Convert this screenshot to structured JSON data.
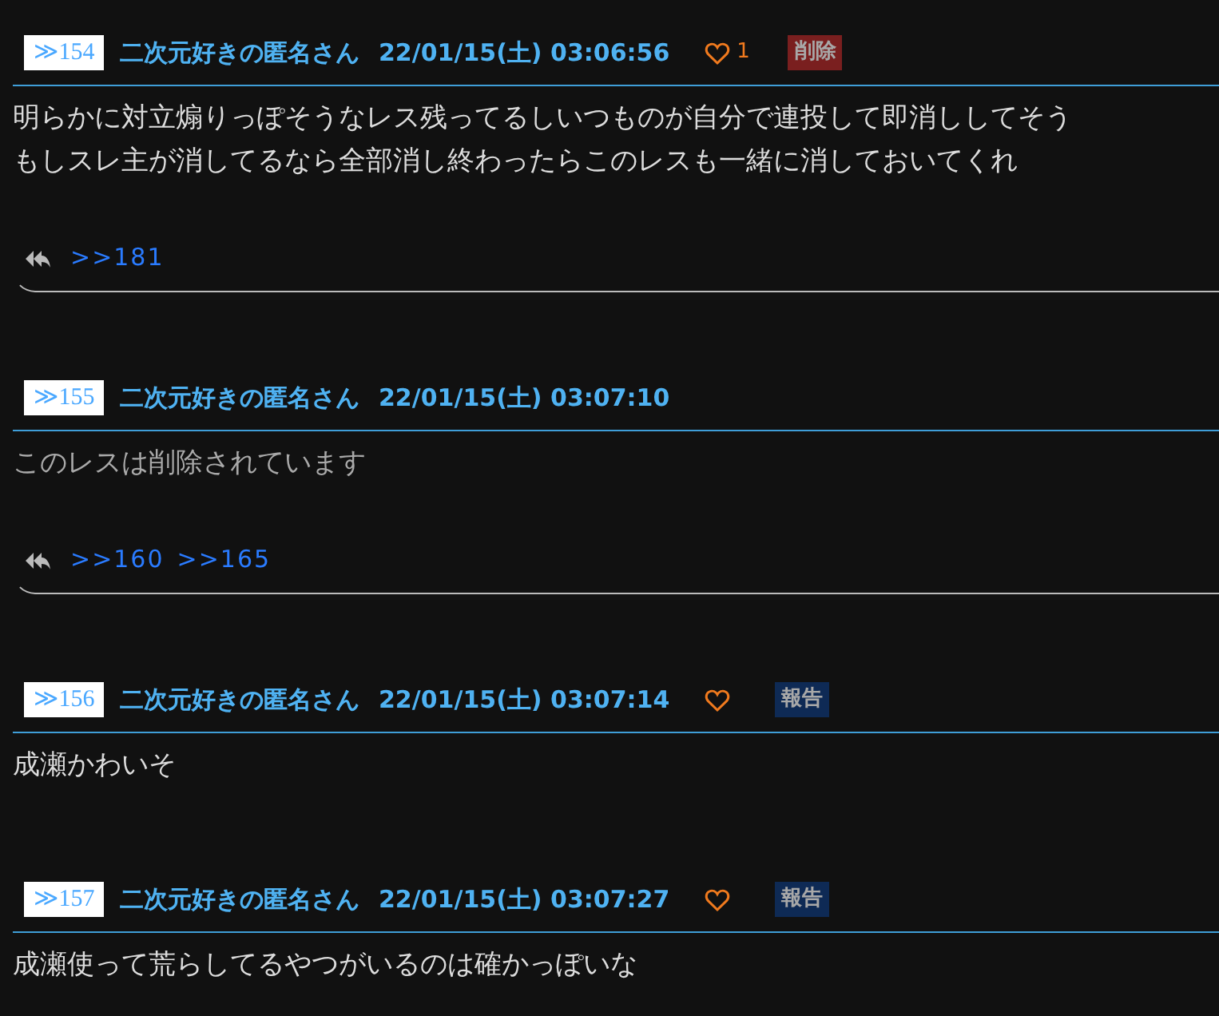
{
  "posts": [
    {
      "number": "≫154",
      "name": "二次元好きの匿名さん",
      "date": "22/01/15(土) 03:06:56",
      "like_button": true,
      "like_count": "1",
      "action": {
        "kind": "delete",
        "label": "削除"
      },
      "deleted": false,
      "body": [
        "明らかに対立煽りっぽそうなレス残ってるしいつものが自分で連投して即消ししてそう",
        "もしスレ主が消してるなら全部消し終わったらこのレスも一緒に消しておいてくれ"
      ],
      "replies": [
        ">>181"
      ]
    },
    {
      "number": "≫155",
      "name": "二次元好きの匿名さん",
      "date": "22/01/15(土) 03:07:10",
      "like_button": false,
      "deleted": true,
      "body": [
        "このレスは削除されています"
      ],
      "replies": [
        ">>160",
        ">>165"
      ]
    },
    {
      "number": "≫156",
      "name": "二次元好きの匿名さん",
      "date": "22/01/15(土) 03:07:14",
      "like_button": true,
      "action": {
        "kind": "report",
        "label": "報告"
      },
      "deleted": false,
      "body": [
        "成瀬かわいそ"
      ]
    },
    {
      "number": "≫157",
      "name": "二次元好きの匿名さん",
      "date": "22/01/15(土) 03:07:27",
      "like_button": true,
      "action": {
        "kind": "report",
        "label": "報告"
      },
      "deleted": false,
      "body": [
        "成瀬使って荒らしてるやつがいるのは確かっぽいな"
      ]
    }
  ]
}
